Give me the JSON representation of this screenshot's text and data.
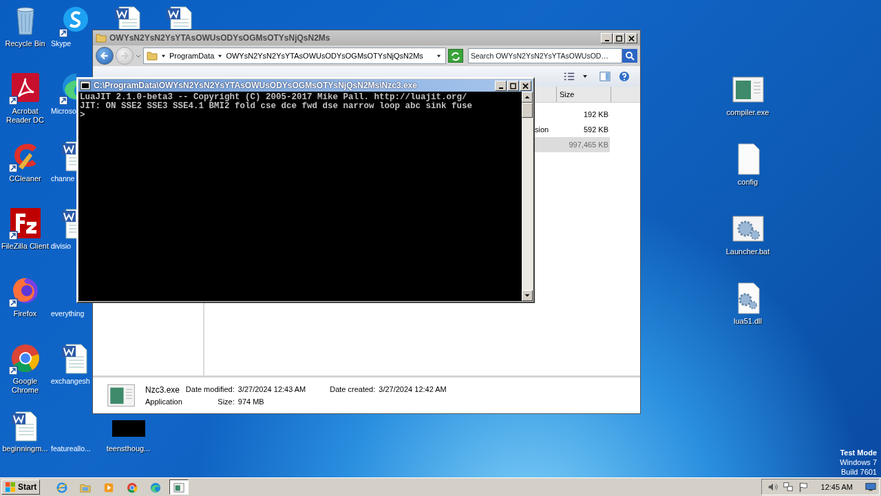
{
  "desktop_icons": [
    {
      "label": "Recycle Bin",
      "kind": "recycle",
      "shortcut": false
    },
    {
      "label": "Skype",
      "kind": "skype",
      "shortcut": true
    },
    {
      "kind": "word"
    },
    {
      "kind": "word"
    },
    {
      "label": "Acrobat Reader DC",
      "kind": "acrobat",
      "shortcut": true
    },
    {
      "label": "Microso",
      "kind": "edge",
      "shortcut": true
    },
    {
      "label": "CCleaner",
      "kind": "ccleaner",
      "shortcut": true
    },
    {
      "label": "channe",
      "kind": "word",
      "shortcut": false
    },
    {
      "label": "FileZilla Client",
      "kind": "filezilla",
      "shortcut": true
    },
    {
      "label": "divisio",
      "kind": "word",
      "shortcut": false
    },
    {
      "label": "Firefox",
      "kind": "firefox",
      "shortcut": true
    },
    {
      "label": "everything",
      "kind": "blank"
    },
    {
      "label": "Google Chrome",
      "kind": "chrome",
      "shortcut": true
    },
    {
      "label": "exchangesh",
      "kind": "word",
      "shortcut": false
    },
    {
      "label": "beginningm...",
      "kind": "word",
      "shortcut": false
    },
    {
      "label": "featureallo...",
      "kind": "blank"
    },
    {
      "label": "teensthoug...",
      "kind": "black"
    }
  ],
  "desktop_icons_right": [
    {
      "label": "compiler.exe",
      "kind": "exe"
    },
    {
      "label": "config",
      "kind": "file"
    },
    {
      "label": "Launcher.bat",
      "kind": "gearwindow"
    },
    {
      "label": "lua51.dll",
      "kind": "gearfile"
    }
  ],
  "explorer": {
    "title": "OWYsN2YsN2YsYTAsOWUsODYsOGMsOTYsNjQsN2Ms",
    "breadcrumb": [
      "ProgramData",
      "OWYsN2YsN2YsYTAsOWUsODYsOGMsOTYsNjQsN2Ms"
    ],
    "search": {
      "placeholder": "Search OWYsN2YsN2YsYTAsOWUsOD…"
    },
    "columns": [
      {
        "label": "Size"
      }
    ],
    "rows": [
      {
        "size": "192 KB",
        "selected": false
      },
      {
        "type": "sion",
        "size": "592 KB",
        "selected": false
      },
      {
        "size": "997,465 KB",
        "selected": true
      }
    ],
    "details": {
      "name": "Nzc3.exe",
      "type": "Application",
      "fields": [
        {
          "label": "Date modified:",
          "value": "3/27/2024 12:43 AM"
        },
        {
          "label": "Date created:",
          "value": "3/27/2024 12:42 AM"
        },
        {
          "label": "Size:",
          "value": "974 MB"
        }
      ]
    }
  },
  "console": {
    "title": "C:\\ProgramData\\OWYsN2YsN2YsYTAsOWUsODYsOGMsOTYsNjQsN2Ms\\Nzc3.exe",
    "lines": [
      "LuaJIT 2.1.0-beta3 -- Copyright (C) 2005-2017 Mike Pall. http://luajit.org/",
      "JIT: ON SSE2 SSE3 SSE4.1 BMI2 fold cse dce fwd dse narrow loop abc sink fuse",
      ">"
    ]
  },
  "os_notice": [
    "Test Mode",
    "Windows 7",
    "Build 7601"
  ],
  "taskbar": {
    "start": "Start",
    "apps": [
      {
        "kind": "ie",
        "active": false
      },
      {
        "kind": "folder",
        "active": false
      },
      {
        "kind": "media",
        "active": false
      },
      {
        "kind": "chrome",
        "active": false
      },
      {
        "kind": "edge",
        "active": false
      },
      {
        "kind": "window",
        "active": true
      }
    ],
    "clock": "12:45 AM"
  }
}
